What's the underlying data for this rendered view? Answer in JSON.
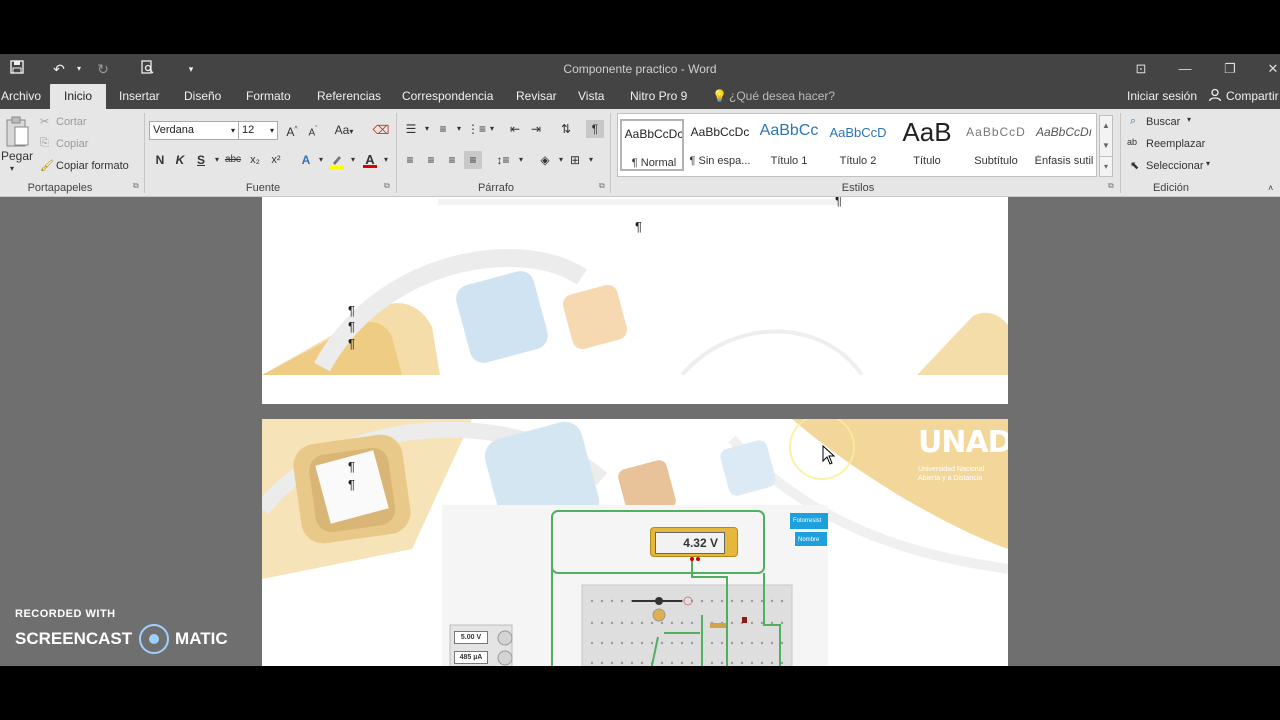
{
  "window": {
    "title": "Componente practico - Word"
  },
  "tabs": {
    "items": [
      "Archivo",
      "Inicio",
      "Insertar",
      "Diseño",
      "Formato",
      "Referencias",
      "Correspondencia",
      "Revisar",
      "Vista",
      "Nitro Pro 9"
    ],
    "search": "¿Qué desea hacer?",
    "signin": "Iniciar sesión",
    "share": "Compartir"
  },
  "clipboard": {
    "paste": "Pegar",
    "cut": "Cortar",
    "copy": "Copiar",
    "format_painter": "Copiar formato",
    "label": "Portapapeles"
  },
  "font": {
    "family": "Verdana",
    "size": "12",
    "label": "Fuente",
    "case_label": "Aa",
    "bold": "N",
    "italic": "K",
    "underline": "S",
    "strike": "abc",
    "subscript": "x₂",
    "superscript": "x²"
  },
  "paragraph": {
    "label": "Párrafo"
  },
  "styles": {
    "label": "Estilos",
    "items": [
      {
        "preview": "AaBbCcDc",
        "name": "¶ Normal"
      },
      {
        "preview": "AaBbCcDc",
        "name": "¶ Sin espa..."
      },
      {
        "preview": "AaBbCc",
        "name": "Título 1"
      },
      {
        "preview": "AaBbCcD",
        "name": "Título 2"
      },
      {
        "preview": "AaB",
        "name": "Título"
      },
      {
        "preview": "AaBbCcD",
        "name": "Subtítulo"
      },
      {
        "preview": "AaBbCcDı",
        "name": "Énfasis sutil"
      }
    ]
  },
  "editing": {
    "find": "Buscar",
    "replace": "Reemplazar",
    "select": "Seleccionar",
    "label": "Edición"
  },
  "document": {
    "pilcrow": "¶",
    "logo_text": "UNAD",
    "logo_sub1": "Universidad Nacional",
    "logo_sub2": "Abierta y a Distancia",
    "multimeter": "4.32 V",
    "supply_voltage": "5.00 V",
    "supply_current": "485 µA",
    "panel_btn1": "Fotorresist",
    "panel_btn2": "Nombre"
  },
  "watermark": {
    "line1": "RECORDED WITH",
    "line2a": "SCREENCAST",
    "line2b": "MATIC"
  }
}
